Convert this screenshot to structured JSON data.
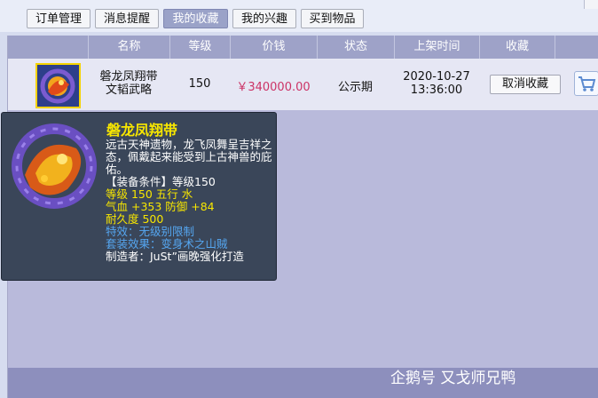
{
  "tabs": [
    {
      "label": "订单管理",
      "active": false
    },
    {
      "label": "消息提醒",
      "active": false
    },
    {
      "label": "我的收藏",
      "active": true
    },
    {
      "label": "我的兴趣",
      "active": false
    },
    {
      "label": "买到物品",
      "active": false
    }
  ],
  "table": {
    "headers": [
      "名称",
      "等级",
      "价钱",
      "状态",
      "上架时间",
      "收藏"
    ],
    "rows": [
      {
        "name_line1": "磐龙凤翔带",
        "name_line2": "文韬武略",
        "level": "150",
        "price": "￥340000.00",
        "status": "公示期",
        "date": "2020-10-27",
        "time": "13:36:00",
        "fav_button": "取消收藏",
        "cart_icon": "cart-icon"
      }
    ]
  },
  "tooltip": {
    "title": "磐龙凤翔带",
    "description": "远古天神遗物，龙飞凤舞呈吉祥之态，佩戴起来能受到上古神兽的庇佑。",
    "requirement": "【装备条件】等级150",
    "level_element": "等级 150  五行 水",
    "stats": "气血 +353 防御 +84",
    "durability": "耐久度 500",
    "special": "特效：无级别限制",
    "set_effect": "套装效果：变身术之山贼",
    "maker": "制造者：JuSt”画晚强化打造"
  },
  "watermark": "企鹅号 又戈师兄鸭",
  "colors": {
    "active_tab": "#9aa2c8",
    "header": "#9ea2c8",
    "price": "#cc3366",
    "tooltip_bg": "#3a4659",
    "tooltip_title": "#f7e600",
    "tooltip_blue": "#55a6f0"
  }
}
